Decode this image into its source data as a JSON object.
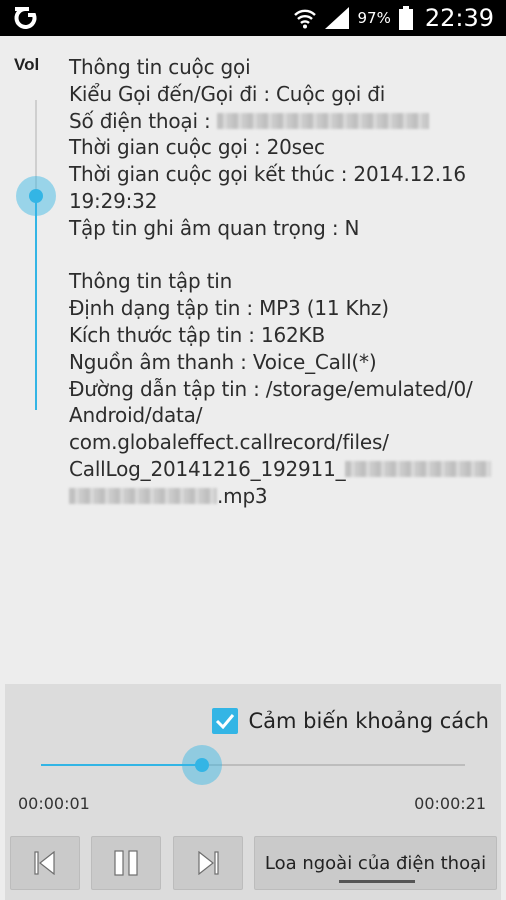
{
  "status_bar": {
    "icons": [
      "carrier-logo-icon",
      "wifi-icon",
      "signal-icon",
      "battery-icon"
    ],
    "battery_percent": "97%",
    "time": "22:39"
  },
  "volume": {
    "label": "Vol",
    "level": 0.69
  },
  "call_info": {
    "title": "Thông tin cuộc gọi",
    "call_type": "Kiểu Gọi đến/Gọi đi : Cuộc gọi đi",
    "phone_label": "Số điện thoại : ",
    "duration": "Thời gian cuộc gọi : 20sec",
    "end_time_line1": "Thời gian cuộc gọi kết thúc : 2014.12.16",
    "end_time_line2": "19:29:32",
    "important": "Tập tin ghi âm quan trọng : N"
  },
  "file_info": {
    "title": "Thông tin tập tin",
    "format": "Định dạng tập tin : MP3 (11 Khz)",
    "size": "Kích thước tập tin : 162KB",
    "source": "Nguồn âm thanh : Voice_Call(*)",
    "path_line1": "Đường dẫn tập tin : /storage/emulated/0/",
    "path_line2": "Android/data/",
    "path_line3": "com.globaleffect.callrecord/files/",
    "path_line4": "CallLog_20141216_192911_",
    "path_line5_suffix": ".mp3"
  },
  "player": {
    "proximity_label": "Cảm biến khoảng cách",
    "proximity_checked": true,
    "elapsed": "00:00:01",
    "total": "00:00:21",
    "progress": 0.38,
    "speaker_button": "Loa ngoài của điện thoại"
  },
  "colors": {
    "accent": "#33b5e5",
    "panel": "#dcdcdc",
    "background": "#ededed"
  }
}
